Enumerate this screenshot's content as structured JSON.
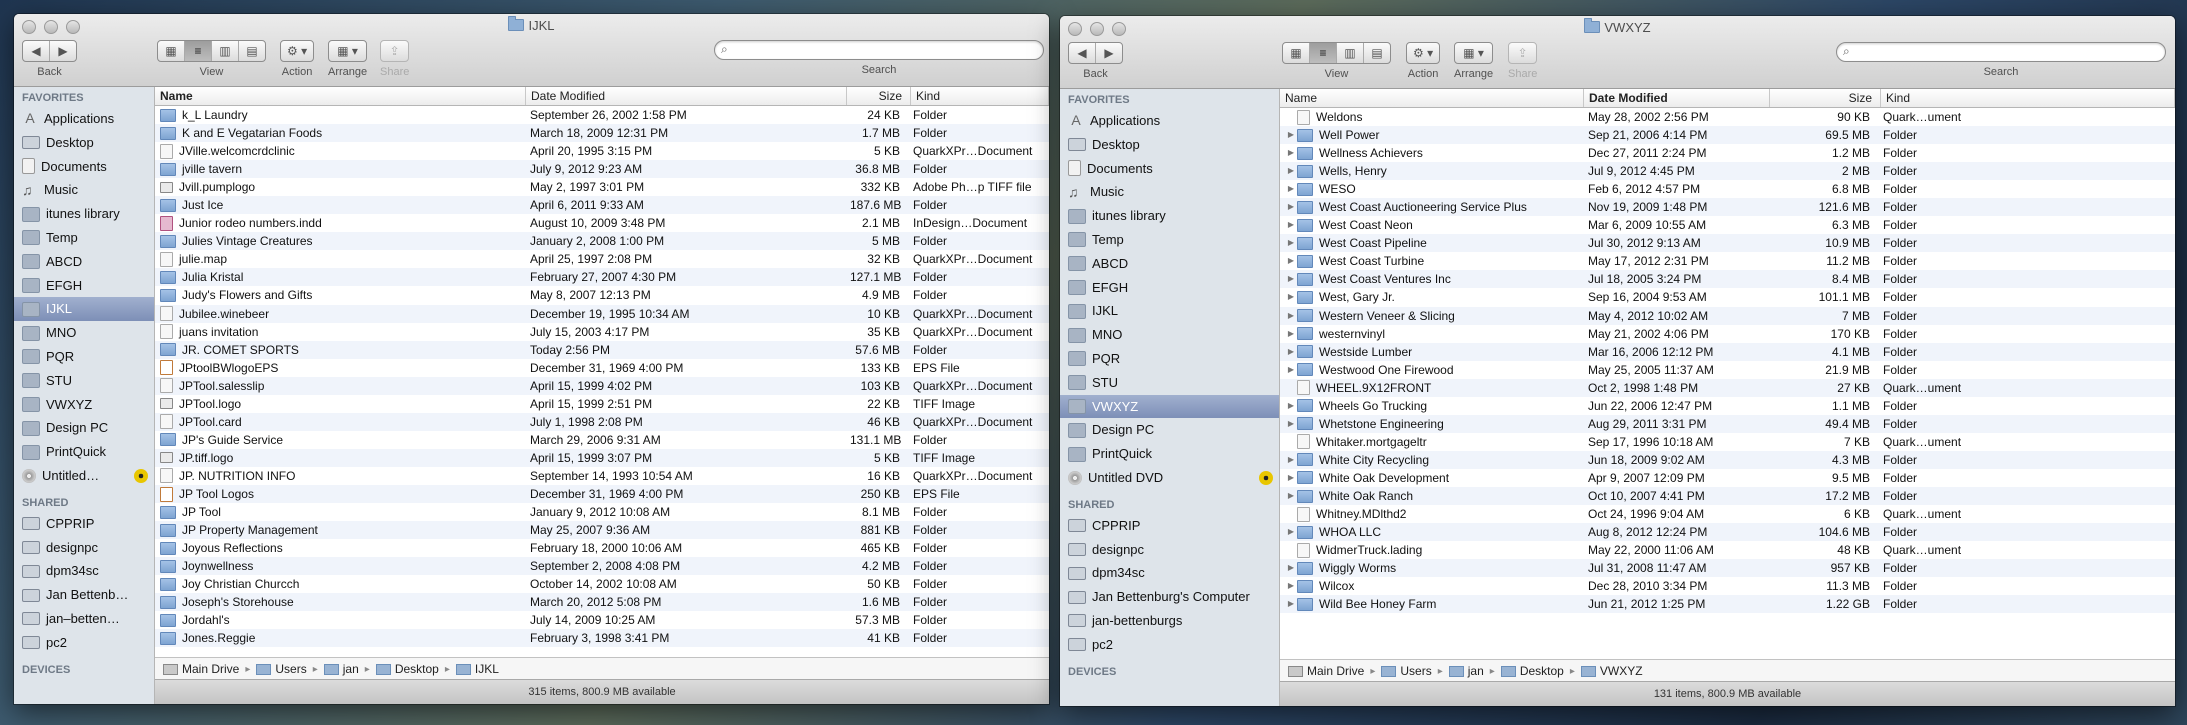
{
  "left": {
    "title": "IJKL",
    "toolbar": {
      "back": "Back",
      "view": "View",
      "action": "Action",
      "arrange": "Arrange",
      "share": "Share",
      "search": "Search"
    },
    "sidebar": {
      "favorites_header": "FAVORITES",
      "favorites": [
        "Applications",
        "Desktop",
        "Documents",
        "Music",
        "itunes library",
        "Temp",
        "ABCD",
        "EFGH",
        "IJKL",
        "MNO",
        "PQR",
        "STU",
        "VWXYZ",
        "Design PC",
        "PrintQuick",
        "Untitled…"
      ],
      "shared_header": "SHARED",
      "shared": [
        "CPPRIP",
        "designpc",
        "dpm34sc",
        "Jan Bettenb…",
        "jan–betten…",
        "pc2"
      ],
      "devices_header": "DEVICES"
    },
    "columns": {
      "name": "Name",
      "date": "Date Modified",
      "size": "Size",
      "kind": "Kind"
    },
    "rows": [
      {
        "name": "k_L Laundry",
        "date": "September 26, 2002 1:58 PM",
        "size": "24 KB",
        "kind": "Folder",
        "icon": "folder"
      },
      {
        "name": "K and E Vegatarian Foods",
        "date": "March 18, 2009 12:31 PM",
        "size": "1.7 MB",
        "kind": "Folder",
        "icon": "folder"
      },
      {
        "name": "JVille.welcomcrdclinic",
        "date": "April 20, 1995 3:15 PM",
        "size": "5 KB",
        "kind": "QuarkXPr…Document",
        "icon": "qx"
      },
      {
        "name": "jville tavern",
        "date": "July 9, 2012 9:23 AM",
        "size": "36.8 MB",
        "kind": "Folder",
        "icon": "folder"
      },
      {
        "name": "Jvill.pumplogo",
        "date": "May 2, 1997 3:01 PM",
        "size": "332 KB",
        "kind": "Adobe Ph…p TIFF file",
        "icon": "tiff"
      },
      {
        "name": "Just Ice",
        "date": "April 6, 2011 9:33 AM",
        "size": "187.6 MB",
        "kind": "Folder",
        "icon": "folder"
      },
      {
        "name": "Junior rodeo numbers.indd",
        "date": "August 10, 2009 3:48 PM",
        "size": "2.1 MB",
        "kind": "InDesign…Document",
        "icon": "indd"
      },
      {
        "name": "Julies Vintage Creatures",
        "date": "January 2, 2008 1:00 PM",
        "size": "5 MB",
        "kind": "Folder",
        "icon": "folder"
      },
      {
        "name": "julie.map",
        "date": "April 25, 1997 2:08 PM",
        "size": "32 KB",
        "kind": "QuarkXPr…Document",
        "icon": "qx"
      },
      {
        "name": "Julia Kristal",
        "date": "February 27, 2007 4:30 PM",
        "size": "127.1 MB",
        "kind": "Folder",
        "icon": "folder"
      },
      {
        "name": "Judy's Flowers and Gifts",
        "date": "May 8, 2007 12:13 PM",
        "size": "4.9 MB",
        "kind": "Folder",
        "icon": "folder"
      },
      {
        "name": "Jubilee.winebeer",
        "date": "December 19, 1995 10:34 AM",
        "size": "10 KB",
        "kind": "QuarkXPr…Document",
        "icon": "qx"
      },
      {
        "name": "juans invitation",
        "date": "July 15, 2003 4:17 PM",
        "size": "35 KB",
        "kind": "QuarkXPr…Document",
        "icon": "qx"
      },
      {
        "name": "JR. COMET SPORTS",
        "date": "Today 2:56 PM",
        "size": "57.6 MB",
        "kind": "Folder",
        "icon": "folder"
      },
      {
        "name": "JPtoolBWlogoEPS",
        "date": "December 31, 1969 4:00 PM",
        "size": "133 KB",
        "kind": "EPS File",
        "icon": "eps"
      },
      {
        "name": "JPTool.salesslip",
        "date": "April 15, 1999 4:02 PM",
        "size": "103 KB",
        "kind": "QuarkXPr…Document",
        "icon": "qx"
      },
      {
        "name": "JPTool.logo",
        "date": "April 15, 1999 2:51 PM",
        "size": "22 KB",
        "kind": "TIFF Image",
        "icon": "tiff"
      },
      {
        "name": "JPTool.card",
        "date": "July 1, 1998 2:08 PM",
        "size": "46 KB",
        "kind": "QuarkXPr…Document",
        "icon": "qx"
      },
      {
        "name": "JP's Guide Service",
        "date": "March 29, 2006 9:31 AM",
        "size": "131.1 MB",
        "kind": "Folder",
        "icon": "folder"
      },
      {
        "name": "JP.tiff.logo",
        "date": "April 15, 1999 3:07 PM",
        "size": "5 KB",
        "kind": "TIFF Image",
        "icon": "tiff"
      },
      {
        "name": "JP. NUTRITION INFO",
        "date": "September 14, 1993 10:54 AM",
        "size": "16 KB",
        "kind": "QuarkXPr…Document",
        "icon": "qx"
      },
      {
        "name": "JP Tool Logos",
        "date": "December 31, 1969 4:00 PM",
        "size": "250 KB",
        "kind": "EPS File",
        "icon": "eps"
      },
      {
        "name": "JP Tool",
        "date": "January 9, 2012 10:08 AM",
        "size": "8.1 MB",
        "kind": "Folder",
        "icon": "folder"
      },
      {
        "name": "JP Property Management",
        "date": "May 25, 2007 9:36 AM",
        "size": "881 KB",
        "kind": "Folder",
        "icon": "folder"
      },
      {
        "name": "Joyous Reflections",
        "date": "February 18, 2000 10:06 AM",
        "size": "465 KB",
        "kind": "Folder",
        "icon": "folder"
      },
      {
        "name": "Joynwellness",
        "date": "September 2, 2008 4:08 PM",
        "size": "4.2 MB",
        "kind": "Folder",
        "icon": "folder"
      },
      {
        "name": "Joy Christian Churcch",
        "date": "October 14, 2002 10:08 AM",
        "size": "50 KB",
        "kind": "Folder",
        "icon": "folder"
      },
      {
        "name": "Joseph's Storehouse",
        "date": "March 20, 2012 5:08 PM",
        "size": "1.6 MB",
        "kind": "Folder",
        "icon": "folder"
      },
      {
        "name": "Jordahl's",
        "date": "July 14, 2009 10:25 AM",
        "size": "57.3 MB",
        "kind": "Folder",
        "icon": "folder"
      },
      {
        "name": "Jones.Reggie",
        "date": "February 3, 1998 3:41 PM",
        "size": "41 KB",
        "kind": "Folder",
        "icon": "folder"
      }
    ],
    "path": [
      "Main Drive",
      "Users",
      "jan",
      "Desktop",
      "IJKL"
    ],
    "status": "315 items, 800.9 MB available"
  },
  "right": {
    "title": "VWXYZ",
    "toolbar": {
      "back": "Back",
      "view": "View",
      "action": "Action",
      "arrange": "Arrange",
      "share": "Share",
      "search": "Search"
    },
    "sidebar": {
      "favorites_header": "FAVORITES",
      "favorites": [
        "Applications",
        "Desktop",
        "Documents",
        "Music",
        "itunes library",
        "Temp",
        "ABCD",
        "EFGH",
        "IJKL",
        "MNO",
        "PQR",
        "STU",
        "VWXYZ",
        "Design PC",
        "PrintQuick",
        "Untitled DVD"
      ],
      "shared_header": "SHARED",
      "shared": [
        "CPPRIP",
        "designpc",
        "dpm34sc",
        "Jan Bettenburg's Computer",
        "jan-bettenburgs",
        "pc2"
      ],
      "devices_header": "DEVICES"
    },
    "columns": {
      "name": "Name",
      "date": "Date Modified",
      "size": "Size",
      "kind": "Kind"
    },
    "rows": [
      {
        "name": "Weldons",
        "date": "May 28, 2002 2:56 PM",
        "size": "90 KB",
        "kind": "Quark…ument",
        "icon": "qx",
        "folder": false
      },
      {
        "name": "Well Power",
        "date": "Sep 21, 2006 4:14 PM",
        "size": "69.5 MB",
        "kind": "Folder",
        "icon": "folder",
        "folder": true
      },
      {
        "name": "Wellness Achievers",
        "date": "Dec 27, 2011 2:24 PM",
        "size": "1.2 MB",
        "kind": "Folder",
        "icon": "folder",
        "folder": true
      },
      {
        "name": "Wells, Henry",
        "date": "Jul 9, 2012 4:45 PM",
        "size": "2 MB",
        "kind": "Folder",
        "icon": "folder",
        "folder": true
      },
      {
        "name": "WESO",
        "date": "Feb 6, 2012 4:57 PM",
        "size": "6.8 MB",
        "kind": "Folder",
        "icon": "folder",
        "folder": true
      },
      {
        "name": "West Coast Auctioneering Service Plus",
        "date": "Nov 19, 2009 1:48 PM",
        "size": "121.6 MB",
        "kind": "Folder",
        "icon": "folder",
        "folder": true
      },
      {
        "name": "West Coast Neon",
        "date": "Mar 6, 2009 10:55 AM",
        "size": "6.3 MB",
        "kind": "Folder",
        "icon": "folder",
        "folder": true
      },
      {
        "name": "West Coast Pipeline",
        "date": "Jul 30, 2012 9:13 AM",
        "size": "10.9 MB",
        "kind": "Folder",
        "icon": "folder",
        "folder": true
      },
      {
        "name": "West Coast Turbine",
        "date": "May 17, 2012 2:31 PM",
        "size": "11.2 MB",
        "kind": "Folder",
        "icon": "folder",
        "folder": true
      },
      {
        "name": "West Coast Ventures Inc",
        "date": "Jul 18, 2005 3:24 PM",
        "size": "8.4 MB",
        "kind": "Folder",
        "icon": "folder",
        "folder": true
      },
      {
        "name": "West, Gary Jr.",
        "date": "Sep 16, 2004 9:53 AM",
        "size": "101.1 MB",
        "kind": "Folder",
        "icon": "folder",
        "folder": true
      },
      {
        "name": "Western Veneer & Slicing",
        "date": "May 4, 2012 10:02 AM",
        "size": "7 MB",
        "kind": "Folder",
        "icon": "folder",
        "folder": true
      },
      {
        "name": "westernvinyl",
        "date": "May 21, 2002 4:06 PM",
        "size": "170 KB",
        "kind": "Folder",
        "icon": "folder",
        "folder": true
      },
      {
        "name": "Westside Lumber",
        "date": "Mar 16, 2006 12:12 PM",
        "size": "4.1 MB",
        "kind": "Folder",
        "icon": "folder",
        "folder": true
      },
      {
        "name": "Westwood One Firewood",
        "date": "May 25, 2005 11:37 AM",
        "size": "21.9 MB",
        "kind": "Folder",
        "icon": "folder",
        "folder": true
      },
      {
        "name": "WHEEL.9X12FRONT",
        "date": "Oct 2, 1998 1:48 PM",
        "size": "27 KB",
        "kind": "Quark…ument",
        "icon": "qx",
        "folder": false
      },
      {
        "name": "Wheels Go Trucking",
        "date": "Jun 22, 2006 12:47 PM",
        "size": "1.1 MB",
        "kind": "Folder",
        "icon": "folder",
        "folder": true
      },
      {
        "name": "Whetstone Engineering",
        "date": "Aug 29, 2011 3:31 PM",
        "size": "49.4 MB",
        "kind": "Folder",
        "icon": "folder",
        "folder": true
      },
      {
        "name": "Whitaker.mortgageltr",
        "date": "Sep 17, 1996 10:18 AM",
        "size": "7 KB",
        "kind": "Quark…ument",
        "icon": "qx",
        "folder": false
      },
      {
        "name": "White City Recycling",
        "date": "Jun 18, 2009 9:02 AM",
        "size": "4.3 MB",
        "kind": "Folder",
        "icon": "folder",
        "folder": true
      },
      {
        "name": "White Oak Development",
        "date": "Apr 9, 2007 12:09 PM",
        "size": "9.5 MB",
        "kind": "Folder",
        "icon": "folder",
        "folder": true
      },
      {
        "name": "White Oak Ranch",
        "date": "Oct 10, 2007 4:41 PM",
        "size": "17.2 MB",
        "kind": "Folder",
        "icon": "folder",
        "folder": true
      },
      {
        "name": "Whitney.MDlthd2",
        "date": "Oct 24, 1996 9:04 AM",
        "size": "6 KB",
        "kind": "Quark…ument",
        "icon": "qx",
        "folder": false
      },
      {
        "name": "WHOA LLC",
        "date": "Aug 8, 2012 12:24 PM",
        "size": "104.6 MB",
        "kind": "Folder",
        "icon": "folder",
        "folder": true
      },
      {
        "name": "WidmerTruck.lading",
        "date": "May 22, 2000 11:06 AM",
        "size": "48 KB",
        "kind": "Quark…ument",
        "icon": "qx",
        "folder": false
      },
      {
        "name": "Wiggly Worms",
        "date": "Jul 31, 2008 11:47 AM",
        "size": "957 KB",
        "kind": "Folder",
        "icon": "folder",
        "folder": true
      },
      {
        "name": "Wilcox",
        "date": "Dec 28, 2010 3:34 PM",
        "size": "11.3 MB",
        "kind": "Folder",
        "icon": "folder",
        "folder": true
      },
      {
        "name": "Wild Bee Honey Farm",
        "date": "Jun 21, 2012 1:25 PM",
        "size": "1.22 GB",
        "kind": "Folder",
        "icon": "folder",
        "folder": true
      }
    ],
    "path": [
      "Main Drive",
      "Users",
      "jan",
      "Desktop",
      "VWXYZ"
    ],
    "status": "131 items, 800.9 MB available"
  }
}
